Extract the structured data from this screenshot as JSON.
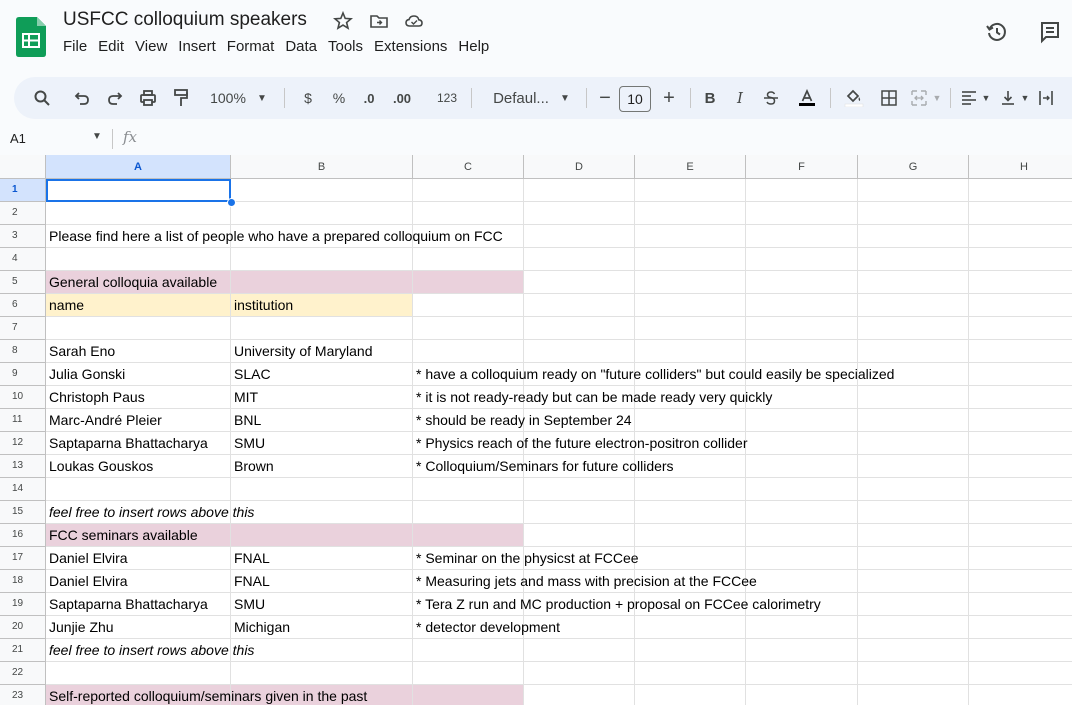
{
  "app": {
    "title": "USFCC colloquium speakers"
  },
  "menu": [
    "File",
    "Edit",
    "View",
    "Insert",
    "Format",
    "Data",
    "Tools",
    "Extensions",
    "Help"
  ],
  "toolbar": {
    "zoom": "100%",
    "currency": "$",
    "percent": "%",
    "dec_decrease": ".0",
    "dec_increase": ".00",
    "number_format": "123",
    "font": "Defaul...",
    "font_size": "10",
    "bold": "B",
    "italic": "I"
  },
  "formula_bar": {
    "cell_ref": "A1",
    "fx": "fx"
  },
  "columns": [
    "A",
    "B",
    "C",
    "D",
    "E",
    "F",
    "G",
    "H"
  ],
  "rows": [
    {
      "num": "1",
      "a": "",
      "b": "",
      "c": ""
    },
    {
      "num": "2",
      "a": "",
      "b": "",
      "c": ""
    },
    {
      "num": "3",
      "a": "Please find here a list of people who have a prepared colloquium on FCC",
      "b": "",
      "c": ""
    },
    {
      "num": "4",
      "a": "",
      "b": "",
      "c": ""
    },
    {
      "num": "5",
      "a": "General colloquia available",
      "b": "",
      "c": "",
      "style": "section"
    },
    {
      "num": "6",
      "a": "name",
      "b": "institution",
      "c": "",
      "style": "header"
    },
    {
      "num": "7",
      "a": "",
      "b": "",
      "c": ""
    },
    {
      "num": "8",
      "a": "Sarah Eno",
      "b": "University of Maryland",
      "c": ""
    },
    {
      "num": "9",
      "a": "Julia Gonski",
      "b": "SLAC",
      "c": "* have a colloquium ready on \"future colliders\" but could easily be specialized"
    },
    {
      "num": "10",
      "a": "Christoph Paus",
      "b": "MIT",
      "c": "* it is not ready-ready but can be made ready very quickly"
    },
    {
      "num": "11",
      "a": "Marc-André Pleier",
      "b": "BNL",
      "c": "* should be ready in September 24"
    },
    {
      "num": "12",
      "a": "Saptaparna Bhattacharya",
      "b": "SMU",
      "c": "* Physics reach of the future electron-positron collider"
    },
    {
      "num": "13",
      "a": "Loukas Gouskos",
      "b": "Brown",
      "c": "* Colloquium/Seminars for future colliders"
    },
    {
      "num": "14",
      "a": "",
      "b": "",
      "c": ""
    },
    {
      "num": "15",
      "a": "feel free to insert rows above this",
      "b": "",
      "c": "",
      "style": "italic"
    },
    {
      "num": "16",
      "a": "FCC seminars available",
      "b": "",
      "c": "",
      "style": "section"
    },
    {
      "num": "17",
      "a": "Daniel Elvira",
      "b": "FNAL",
      "c": "* Seminar on the physicst at FCCee"
    },
    {
      "num": "18",
      "a": "Daniel Elvira",
      "b": "FNAL",
      "c": "* Measuring jets and mass with precision at the FCCee"
    },
    {
      "num": "19",
      "a": "Saptaparna Bhattacharya",
      "b": "SMU",
      "c": "* Tera Z run and MC production + proposal on FCCee calorimetry"
    },
    {
      "num": "20",
      "a": "Junjie Zhu",
      "b": "Michigan",
      "c": "* detector development"
    },
    {
      "num": "21",
      "a": "feel free to insert rows above this",
      "b": "",
      "c": "",
      "style": "italic"
    },
    {
      "num": "22",
      "a": "",
      "b": "",
      "c": ""
    },
    {
      "num": "23",
      "a": "Self-reported colloquium/seminars given in the past",
      "b": "",
      "c": "",
      "style": "section"
    }
  ],
  "colors": {
    "section_fill": "#ead1dc",
    "header_fill": "#fff2cc",
    "selection": "#1a73e8",
    "logo_green": "#0f9d58"
  },
  "icons": [
    "sheets-logo-icon",
    "star-icon",
    "move-to-folder-icon",
    "cloud-status-icon",
    "history-icon",
    "comment-icon",
    "search-icon",
    "undo-icon",
    "redo-icon",
    "print-icon",
    "paint-format-icon",
    "borders-icon",
    "merge-cells-icon",
    "align-left-icon",
    "valign-bottom-icon"
  ]
}
